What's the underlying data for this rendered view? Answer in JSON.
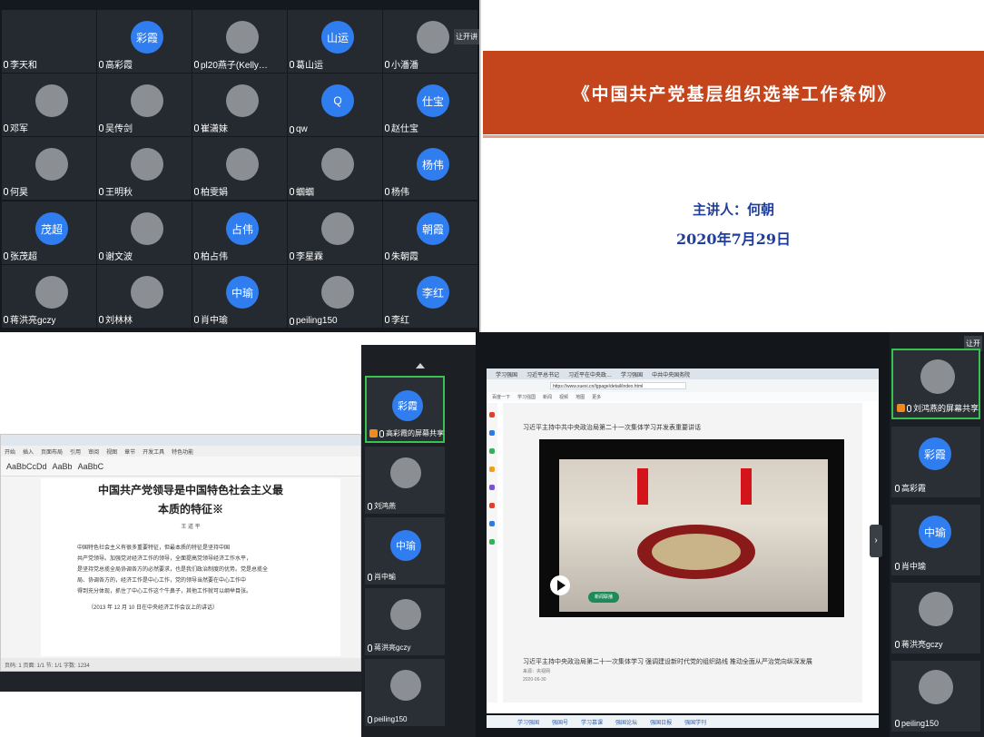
{
  "grid": {
    "participants": [
      {
        "name": "李天和",
        "avatar": "",
        "kind": "none"
      },
      {
        "name": "高彩霞",
        "avatar": "彩霞",
        "kind": "bubble"
      },
      {
        "name": "pl20燕子(Kelly…",
        "avatar": "",
        "kind": "photo"
      },
      {
        "name": "葛山运",
        "avatar": "山运",
        "kind": "bubble"
      },
      {
        "name": "小潘潘",
        "avatar": "",
        "kind": "photo"
      },
      {
        "name": "邓军",
        "avatar": "",
        "kind": "photo"
      },
      {
        "name": "吴传剑",
        "avatar": "",
        "kind": "photo"
      },
      {
        "name": "崔潇妹",
        "avatar": "",
        "kind": "photo"
      },
      {
        "name": "qw",
        "avatar": "Q",
        "kind": "bubble"
      },
      {
        "name": "赵仕宝",
        "avatar": "仕宝",
        "kind": "bubble"
      },
      {
        "name": "何昊",
        "avatar": "",
        "kind": "photo"
      },
      {
        "name": "王明秋",
        "avatar": "",
        "kind": "photo"
      },
      {
        "name": "柏雯娟",
        "avatar": "",
        "kind": "photo"
      },
      {
        "name": "蝈蝈",
        "avatar": "",
        "kind": "photo"
      },
      {
        "name": "杨伟",
        "avatar": "杨伟",
        "kind": "bubble"
      },
      {
        "name": "张茂超",
        "avatar": "茂超",
        "kind": "bubble"
      },
      {
        "name": "谢文波",
        "avatar": "",
        "kind": "photo"
      },
      {
        "name": "柏占伟",
        "avatar": "占伟",
        "kind": "bubble"
      },
      {
        "name": "李星霖",
        "avatar": "",
        "kind": "photo"
      },
      {
        "name": "朱朝霞",
        "avatar": "朝霞",
        "kind": "bubble"
      },
      {
        "name": "蒋洪亮gczy",
        "avatar": "",
        "kind": "photo"
      },
      {
        "name": "刘林林",
        "avatar": "",
        "kind": "photo"
      },
      {
        "name": "肖中瑜",
        "avatar": "中瑜",
        "kind": "bubble"
      },
      {
        "name": "peiling150",
        "avatar": "",
        "kind": "photo"
      },
      {
        "name": "李红",
        "avatar": "李红",
        "kind": "bubble"
      }
    ],
    "side_tag": "让开讲"
  },
  "slide": {
    "title": "《中国共产党基层组织选举工作条例》",
    "speaker": "主讲人：何朝",
    "date": "2020年7月29日"
  },
  "left_share": {
    "sidebar": [
      {
        "name": "高彩霞的屏幕共享",
        "avatar": "彩霞",
        "kind": "bubble"
      },
      {
        "name": "刘鸿燕",
        "avatar": "",
        "kind": "photo"
      },
      {
        "name": "肖中瑜",
        "avatar": "中瑜",
        "kind": "bubble"
      },
      {
        "name": "蒋洪亮gczy",
        "avatar": "",
        "kind": "photo"
      },
      {
        "name": "peiling150",
        "avatar": "",
        "kind": "photo"
      }
    ],
    "doc": {
      "menu": [
        "开始",
        "插入",
        "页面布局",
        "引用",
        "审阅",
        "视图",
        "章节",
        "开发工具",
        "特色功能"
      ],
      "ribbon": [
        "AaBbCcDd",
        "AaBb",
        "AaBbC"
      ],
      "heading1": "中国共产党领导是中国特色社会主义最",
      "heading2": "本质的特征※",
      "byline": "王 道 平",
      "body": [
        "中国特色社会主义有很多重要特征，但最本质的特征是坚持中国",
        "共产党领导。加强党对经济工作的领导，全面提高党领导经济工作水平，",
        "是坚持党总揽全局协调各方的必然要求，也是我们政治制度的优势。党是总揽全",
        "局、协调各方的，经济工作是中心工作，党的领导当然要在中心工作中",
        "得到充分体现，抓住了中心工作这个牛鼻子，其他工作就可以纲举目张。"
      ],
      "foot": "（2013 年 12 月 10 日在中央经济工作会议上的讲话）",
      "status": "页码: 1  页面: 1/1  节: 1/1  字数: 1234"
    }
  },
  "right_share": {
    "tabs": [
      "学习强国",
      "习近平总书记",
      "习近平在中央政…",
      "学习强国",
      "中共中央国务院"
    ],
    "url": "https://www.xuexi.cn/lgpage/detail/index.html",
    "bookmarks": [
      "百度一下",
      "学习强国",
      "新闻",
      "视频",
      "地图",
      "更多"
    ],
    "headline": "习近平主持中共中央政治局第二十一次集体学习并发表重要讲话",
    "caption": "习近平主持中央政治局第二十一次集体学习 强调建设新时代党的组织路线 推动全面从严治党向纵深发展",
    "meta1": "来源：央视网",
    "meta2": "2020-06-30",
    "badge": "新闻联播",
    "bottom_links": [
      "学习强国",
      "强国号",
      "学习慕课",
      "强国论坛",
      "强国日报",
      "强国学刊"
    ],
    "sidebar": [
      {
        "name": "刘鸿燕的屏幕共享",
        "avatar": "",
        "kind": "photo"
      },
      {
        "name": "高彩霞",
        "avatar": "彩霞",
        "kind": "bubble"
      },
      {
        "name": "肖中瑜",
        "avatar": "中瑜",
        "kind": "bubble"
      },
      {
        "name": "蒋洪亮gczy",
        "avatar": "",
        "kind": "photo"
      },
      {
        "name": "peiling150",
        "avatar": "",
        "kind": "photo"
      }
    ],
    "side_tag": "让开"
  }
}
